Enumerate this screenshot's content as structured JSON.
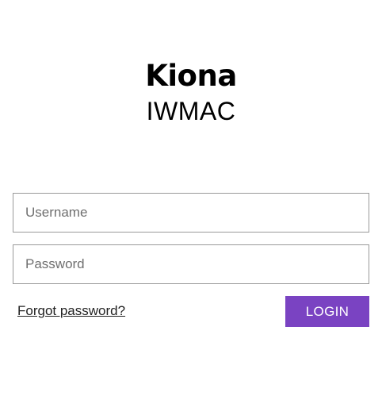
{
  "brand": {
    "logo_text": "Kiona",
    "product_name": "IWMAC"
  },
  "login_form": {
    "username_placeholder": "Username",
    "username_value": "",
    "password_placeholder": "Password",
    "password_value": "",
    "forgot_password_label": "Forgot password?",
    "login_button_label": "LOGIN"
  },
  "colors": {
    "accent": "#7a43c2",
    "field_border": "#9a9a9a",
    "placeholder_text": "#6f6f6f",
    "background": "#ffffff"
  }
}
